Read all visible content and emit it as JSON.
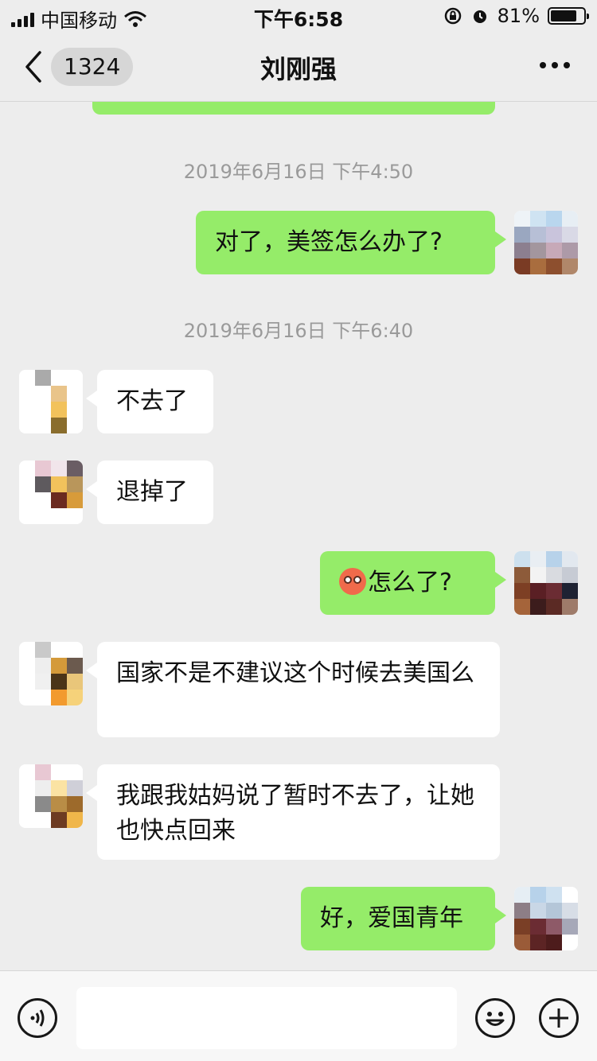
{
  "status_bar": {
    "carrier": "中国移动",
    "time": "下午6:58",
    "battery": "81%",
    "battery_level": 0.81
  },
  "nav": {
    "unread_count": "1324",
    "title": "刘刚强"
  },
  "messages": {
    "ts1": "2019年6月16日 下午4:50",
    "m1": "对了，美签怎么办了?",
    "ts2": "2019年6月16日 下午6:40",
    "m2": "不去了",
    "m3": "退掉了",
    "m4": "怎么了?",
    "m4_emoji": "flushed-face-emoji",
    "m5": "国家不是不建议这个时候去美国么",
    "m6": "我跟我姑妈说了暂时不去了，让她也快点回来",
    "m7": "好，爱国青年"
  },
  "colors": {
    "background": "#ededed",
    "sent_bubble": "#95ec69",
    "received_bubble": "#ffffff",
    "timestamp": "#9a9a9a"
  },
  "input_bar": {
    "voice_icon": "voice-icon",
    "emoji_icon": "emoji-icon",
    "add_icon": "plus-icon"
  }
}
